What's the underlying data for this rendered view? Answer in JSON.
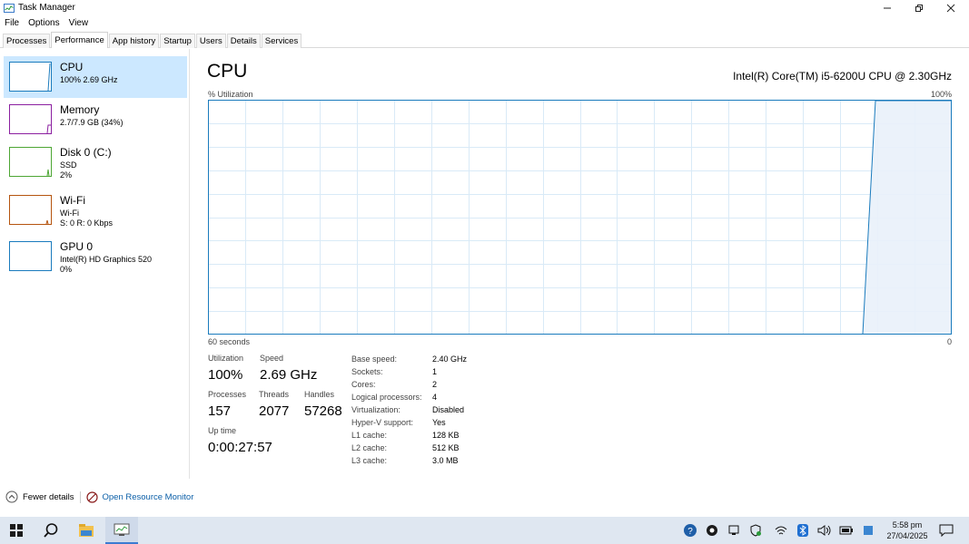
{
  "window": {
    "title": "Task Manager"
  },
  "menu": [
    "File",
    "Options",
    "View"
  ],
  "tabs": [
    {
      "label": "Processes",
      "active": false
    },
    {
      "label": "Performance",
      "active": true
    },
    {
      "label": "App history",
      "active": false
    },
    {
      "label": "Startup",
      "active": false
    },
    {
      "label": "Users",
      "active": false
    },
    {
      "label": "Details",
      "active": false
    },
    {
      "label": "Services",
      "active": false
    }
  ],
  "sidebar": [
    {
      "name": "CPU",
      "line1": "100%  2.69 GHz",
      "line2": "",
      "color": "#1a7bbd",
      "selected": true
    },
    {
      "name": "Memory",
      "line1": "2.7/7.9 GB (34%)",
      "line2": "",
      "color": "#8b1fa0",
      "selected": false
    },
    {
      "name": "Disk 0 (C:)",
      "line1": "SSD",
      "line2": "2%",
      "color": "#4da634",
      "selected": false
    },
    {
      "name": "Wi-Fi",
      "line1": "Wi-Fi",
      "line2": "S: 0  R: 0 Kbps",
      "color": "#b5540f",
      "selected": false
    },
    {
      "name": "GPU 0",
      "line1": "Intel(R) HD Graphics 520",
      "line2": "0%",
      "color": "#1a7bbd",
      "selected": false
    }
  ],
  "main": {
    "title": "CPU",
    "cpu_model": "Intel(R) Core(TM) i5-6200U CPU @ 2.30GHz",
    "y_label": "% Utilization",
    "y_max": "100%",
    "x_left": "60 seconds",
    "x_right": "0",
    "graph_color": "#1a7bbd",
    "utilization_label": "Utilization",
    "utilization": "100%",
    "speed_label": "Speed",
    "speed": "2.69 GHz",
    "processes_label": "Processes",
    "processes": "157",
    "threads_label": "Threads",
    "threads": "2077",
    "handles_label": "Handles",
    "handles": "57268",
    "uptime_label": "Up time",
    "uptime": "0:00:27:57",
    "specs": [
      {
        "k": "Base speed:",
        "v": "2.40 GHz"
      },
      {
        "k": "Sockets:",
        "v": "1"
      },
      {
        "k": "Cores:",
        "v": "2"
      },
      {
        "k": "Logical processors:",
        "v": "4"
      },
      {
        "k": "Virtualization:",
        "v": "Disabled"
      },
      {
        "k": "Hyper-V support:",
        "v": "Yes"
      },
      {
        "k": "L1 cache:",
        "v": "128 KB"
      },
      {
        "k": "L2 cache:",
        "v": "512 KB"
      },
      {
        "k": "L3 cache:",
        "v": "3.0 MB"
      }
    ]
  },
  "footer": {
    "fewer_details": "Fewer details",
    "resource_monitor": "Open Resource Monitor"
  },
  "taskbar": {
    "time": "5:58 pm",
    "date": "27/04/2025"
  }
}
